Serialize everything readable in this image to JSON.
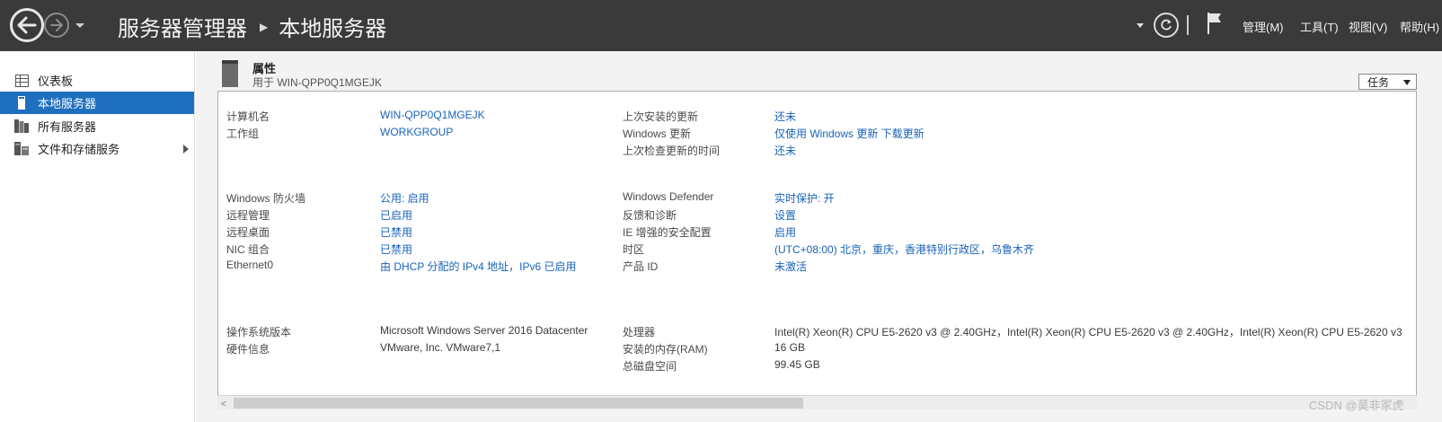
{
  "header": {
    "breadcrumb_root": "服务器管理器",
    "breadcrumb_current": "本地服务器",
    "menu": [
      "管理(M)",
      "工具(T)",
      "视图(V)",
      "帮助(H)"
    ]
  },
  "sidebar": {
    "items": [
      {
        "label": "仪表板",
        "icon": "dashboard-icon"
      },
      {
        "label": "本地服务器",
        "icon": "server-icon"
      },
      {
        "label": "所有服务器",
        "icon": "servers-icon"
      },
      {
        "label": "文件和存储服务",
        "icon": "storage-icon"
      }
    ]
  },
  "properties": {
    "title": "属性",
    "subtitle": "用于 WIN-QPP0Q1MGEJK",
    "tasks_label": "任务",
    "group1": {
      "computer_name_label": "计算机名",
      "computer_name": "WIN-QPP0Q1MGEJK",
      "workgroup_label": "工作组",
      "workgroup": "WORKGROUP",
      "last_install_label": "上次安装的更新",
      "last_install": "还未",
      "windows_update_label": "Windows 更新",
      "windows_update": "仅使用 Windows 更新 下载更新",
      "last_check_label": "上次检查更新的时间",
      "last_check": "还未"
    },
    "group2": {
      "firewall_label": "Windows 防火墙",
      "firewall": "公用: 启用",
      "remote_mgmt_label": "远程管理",
      "remote_mgmt": "已启用",
      "remote_desktop_label": "远程桌面",
      "remote_desktop": "已禁用",
      "nic_label": "NIC 组合",
      "nic": "已禁用",
      "ethernet_label": "Ethernet0",
      "ethernet": "由 DHCP 分配的 IPv4 地址，IPv6 已启用",
      "defender_label": "Windows Defender",
      "defender": "实时保护: 开",
      "feedback_label": "反馈和诊断",
      "feedback": "设置",
      "ie_label": "IE 增强的安全配置",
      "ie": "启用",
      "timezone_label": "时区",
      "timezone": "(UTC+08:00) 北京，重庆，香港特别行政区，乌鲁木齐",
      "product_label": "产品 ID",
      "product": "未激活"
    },
    "group3": {
      "os_label": "操作系统版本",
      "os": "Microsoft Windows Server 2016 Datacenter",
      "hw_label": "硬件信息",
      "hw": "VMware, Inc. VMware7,1",
      "cpu_label": "处理器",
      "cpu": "Intel(R) Xeon(R) CPU E5-2620 v3 @ 2.40GHz，Intel(R) Xeon(R) CPU E5-2620 v3 @ 2.40GHz，Intel(R) Xeon(R) CPU E5-2620 v3",
      "ram_label": "安装的内存(RAM)",
      "ram": "16 GB",
      "disk_label": "总磁盘空间",
      "disk": "99.45 GB"
    }
  },
  "watermark": "CSDN @莫非冢虎"
}
